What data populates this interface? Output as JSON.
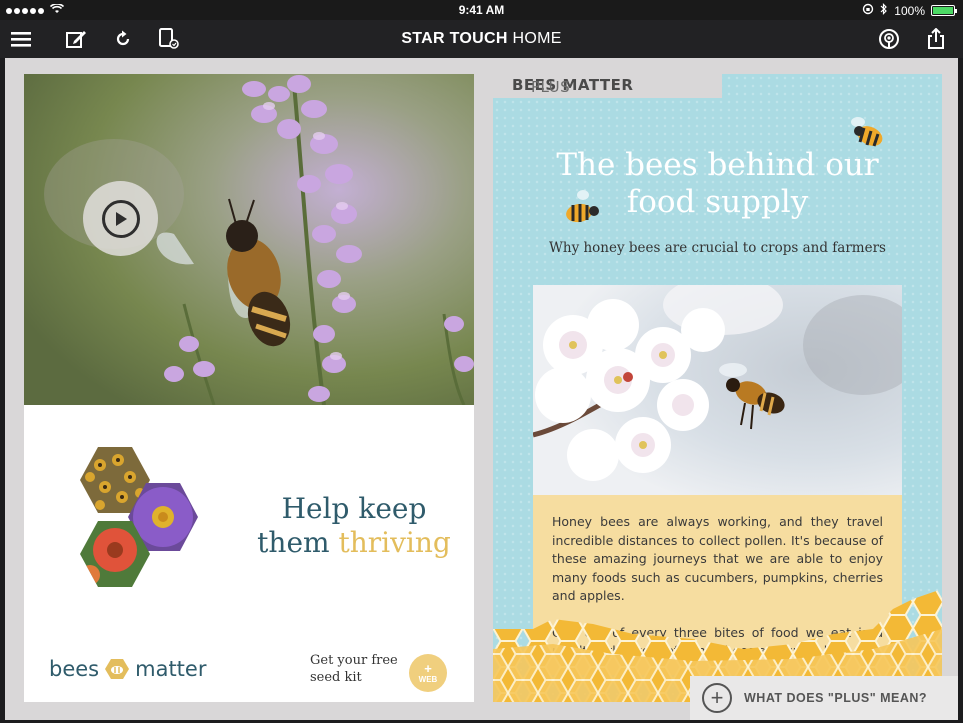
{
  "status_bar": {
    "time": "9:41 AM",
    "battery": "100%"
  },
  "navbar": {
    "title_bold": "STAR TOUCH",
    "title_rest": "HOME"
  },
  "left_card": {
    "help_line1": "Help keep",
    "help_line2_a": "them ",
    "help_line2_b": "thriving",
    "brand_left": "bees",
    "brand_right": "matter",
    "seed_line1": "Get your free",
    "seed_line2": "seed kit",
    "web_plus": "+",
    "web_label": "WEB"
  },
  "right_card": {
    "tab_plain": "PLUS ",
    "tab_bold": "BEES MATTER",
    "title_line1": "The bees behind our",
    "title_line2": "food supply",
    "subtitle": "Why honey bees are crucial to crops and farmers",
    "paragraph1": "Honey bees are always working, and they travel incredible distances to collect pollen. It's because of these amazing journeys that we are able to enjoy many foods such as cucumbers, pumpkins, cherries and apples.",
    "paragraph2": "One out of every three bites of food we eat is a result of the work of honey bees and crops like"
  },
  "what_plus": {
    "label": "WHAT DOES \"PLUS\" MEAN?",
    "icon": "+"
  },
  "colors": {
    "accent_yellow": "#e3bd5c",
    "teal_text": "#2f5b6b",
    "sky": "#abdbe3",
    "honey_box": "#f6dda0"
  }
}
